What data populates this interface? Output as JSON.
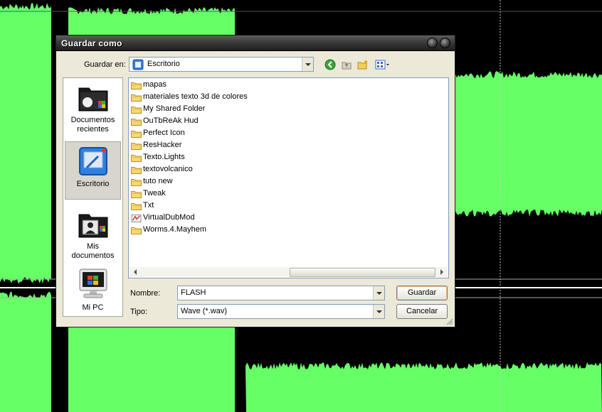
{
  "dialog": {
    "title": "Guardar como",
    "save_in_label": "Guardar en:",
    "save_in_value": "Escritorio",
    "places": [
      {
        "label": "Documentos recientes",
        "icon": "recent-documents-icon"
      },
      {
        "label": "Escritorio",
        "icon": "desktop-icon",
        "selected": true
      },
      {
        "label": "Mis documentos",
        "icon": "my-documents-icon"
      },
      {
        "label": "Mi PC",
        "icon": "my-computer-icon"
      }
    ],
    "files": [
      {
        "name": "mapas",
        "icon": "folder-icon"
      },
      {
        "name": "materiales texto 3d de colores",
        "icon": "folder-icon"
      },
      {
        "name": "My Shared Folder",
        "icon": "folder-icon"
      },
      {
        "name": "OuTbReAk Hud",
        "icon": "folder-icon"
      },
      {
        "name": "Perfect Icon",
        "icon": "folder-icon"
      },
      {
        "name": "ResHacker",
        "icon": "folder-icon"
      },
      {
        "name": "Texto.Lights",
        "icon": "folder-icon"
      },
      {
        "name": "textovolcanico",
        "icon": "folder-icon"
      },
      {
        "name": "tuto new",
        "icon": "folder-icon"
      },
      {
        "name": "Tweak",
        "icon": "folder-icon"
      },
      {
        "name": "Txt",
        "icon": "folder-icon"
      },
      {
        "name": "VirtualDubMod",
        "icon": "shortcut-icon"
      },
      {
        "name": "Worms.4.Mayhem",
        "icon": "folder-icon"
      }
    ],
    "filename_label": "Nombre:",
    "filename_value": "FLASH",
    "type_label": "Tipo:",
    "type_value": "Wave (*.wav)",
    "save_button": "Guardar",
    "cancel_button": "Cancelar"
  },
  "colors": {
    "waveform": "#66ff66",
    "background": "#000000",
    "dialog_face": "#ece9d8"
  }
}
